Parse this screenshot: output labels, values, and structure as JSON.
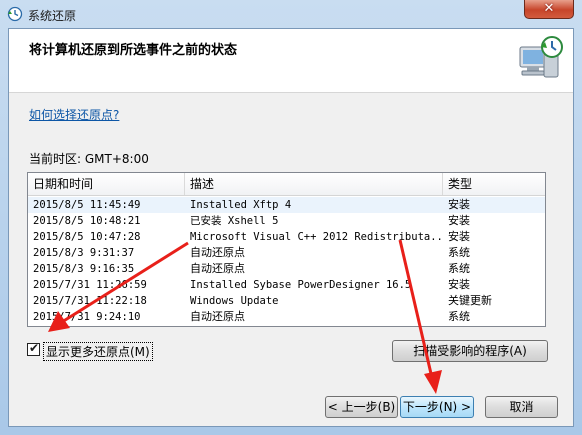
{
  "window": {
    "title": "系统还原"
  },
  "header": {
    "title": "将计算机还原到所选事件之前的状态"
  },
  "help_link": "如何选择还原点?",
  "timezone": "当前时区: GMT+8:00",
  "table": {
    "columns": [
      "日期和时间",
      "描述",
      "类型"
    ],
    "rows": [
      {
        "date": "2015/8/5 11:45:49",
        "desc": "Installed Xftp 4",
        "type": "安装"
      },
      {
        "date": "2015/8/5 10:48:21",
        "desc": "已安装 Xshell 5",
        "type": "安装"
      },
      {
        "date": "2015/8/5 10:47:28",
        "desc": "Microsoft Visual C++ 2012 Redistributa...",
        "type": "安装"
      },
      {
        "date": "2015/8/3 9:31:37",
        "desc": "自动还原点",
        "type": "系统"
      },
      {
        "date": "2015/8/3 9:16:35",
        "desc": "自动还原点",
        "type": "系统"
      },
      {
        "date": "2015/7/31 11:26:59",
        "desc": "Installed Sybase PowerDesigner 16.5",
        "type": "安装"
      },
      {
        "date": "2015/7/31 11:22:18",
        "desc": "Windows Update",
        "type": "关键更新"
      },
      {
        "date": "2015/7/31 9:24:10",
        "desc": "自动还原点",
        "type": "系统"
      }
    ]
  },
  "show_more": {
    "label": "显示更多还原点(M)",
    "checked": true
  },
  "buttons": {
    "scan": "扫描受影响的程序(A)",
    "back": "< 上一步(B)",
    "next": "下一步(N) >",
    "cancel": "取消"
  },
  "colors": {
    "annotation_arrow": "#e8201a",
    "link": "#0d56a6"
  }
}
